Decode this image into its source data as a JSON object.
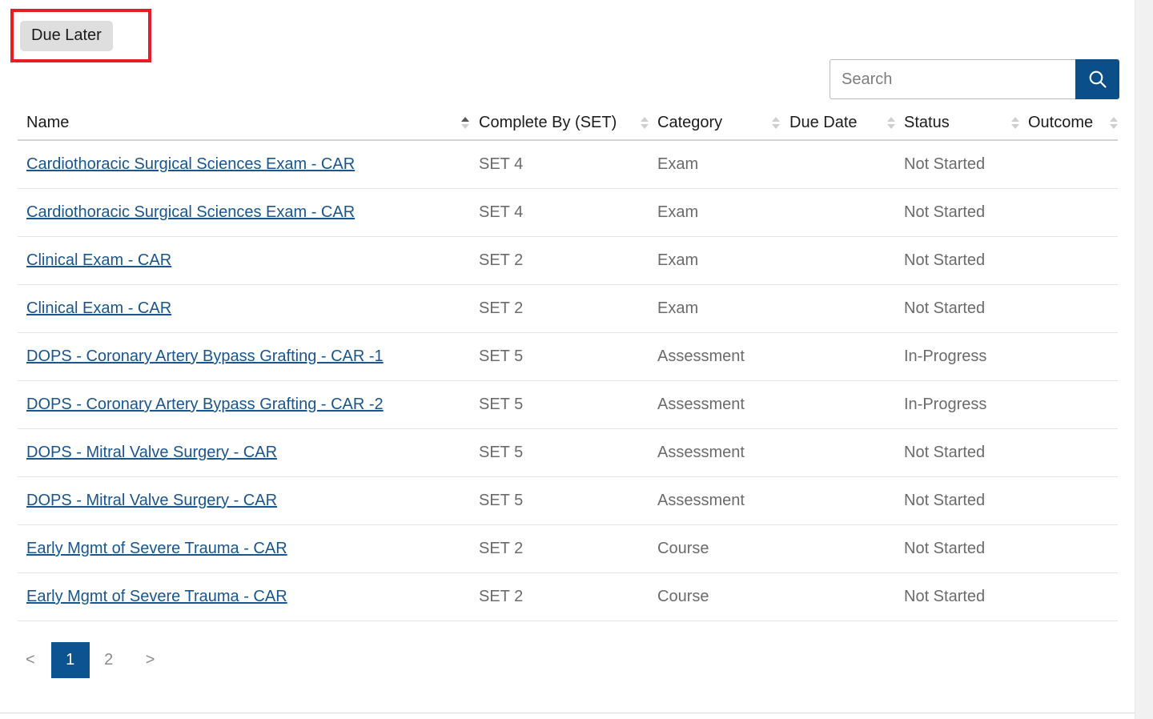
{
  "tabs": {
    "items": [
      {
        "label": "Due Later",
        "selected": true,
        "highlighted": true
      }
    ],
    "highlight_color": "#e81c24"
  },
  "search": {
    "value": "",
    "placeholder": "Search",
    "button_icon": "search-icon",
    "button_color": "#0b4f8a"
  },
  "table": {
    "columns": [
      {
        "label": "Name",
        "sortable": true,
        "sort": "asc"
      },
      {
        "label": "Complete By (SET)",
        "sortable": true,
        "sort": "none"
      },
      {
        "label": "Category",
        "sortable": true,
        "sort": "none"
      },
      {
        "label": "Due Date",
        "sortable": true,
        "sort": "none"
      },
      {
        "label": "Status",
        "sortable": true,
        "sort": "none"
      },
      {
        "label": "Outcome",
        "sortable": true,
        "sort": "none"
      }
    ],
    "rows": [
      {
        "name": "Cardiothoracic Surgical Sciences Exam - CAR",
        "complete_by": "SET 4",
        "category": "Exam",
        "due_date": "",
        "status": "Not Started",
        "outcome": ""
      },
      {
        "name": "Cardiothoracic Surgical Sciences Exam - CAR",
        "complete_by": "SET 4",
        "category": "Exam",
        "due_date": "",
        "status": "Not Started",
        "outcome": ""
      },
      {
        "name": "Clinical Exam - CAR",
        "complete_by": "SET 2",
        "category": "Exam",
        "due_date": "",
        "status": "Not Started",
        "outcome": ""
      },
      {
        "name": "Clinical Exam - CAR",
        "complete_by": "SET 2",
        "category": "Exam",
        "due_date": "",
        "status": "Not Started",
        "outcome": ""
      },
      {
        "name": "DOPS - Coronary Artery Bypass Grafting - CAR -1",
        "complete_by": "SET 5",
        "category": "Assessment",
        "due_date": "",
        "status": "In-Progress",
        "outcome": ""
      },
      {
        "name": "DOPS - Coronary Artery Bypass Grafting - CAR -2",
        "complete_by": "SET 5",
        "category": "Assessment",
        "due_date": "",
        "status": "In-Progress",
        "outcome": ""
      },
      {
        "name": "DOPS - Mitral Valve Surgery - CAR",
        "complete_by": "SET 5",
        "category": "Assessment",
        "due_date": "",
        "status": "Not Started",
        "outcome": ""
      },
      {
        "name": "DOPS - Mitral Valve Surgery - CAR",
        "complete_by": "SET 5",
        "category": "Assessment",
        "due_date": "",
        "status": "Not Started",
        "outcome": ""
      },
      {
        "name": "Early Mgmt of Severe Trauma - CAR",
        "complete_by": "SET 2",
        "category": "Course",
        "due_date": "",
        "status": "Not Started",
        "outcome": ""
      },
      {
        "name": "Early Mgmt of Severe Trauma - CAR",
        "complete_by": "SET 2",
        "category": "Course",
        "due_date": "",
        "status": "Not Started",
        "outcome": ""
      }
    ],
    "link_color": "#19558f"
  },
  "pagination": {
    "prev_label": "<",
    "next_label": ">",
    "pages": [
      "1",
      "2"
    ],
    "current_page": "1",
    "active_color": "#0b5391"
  }
}
